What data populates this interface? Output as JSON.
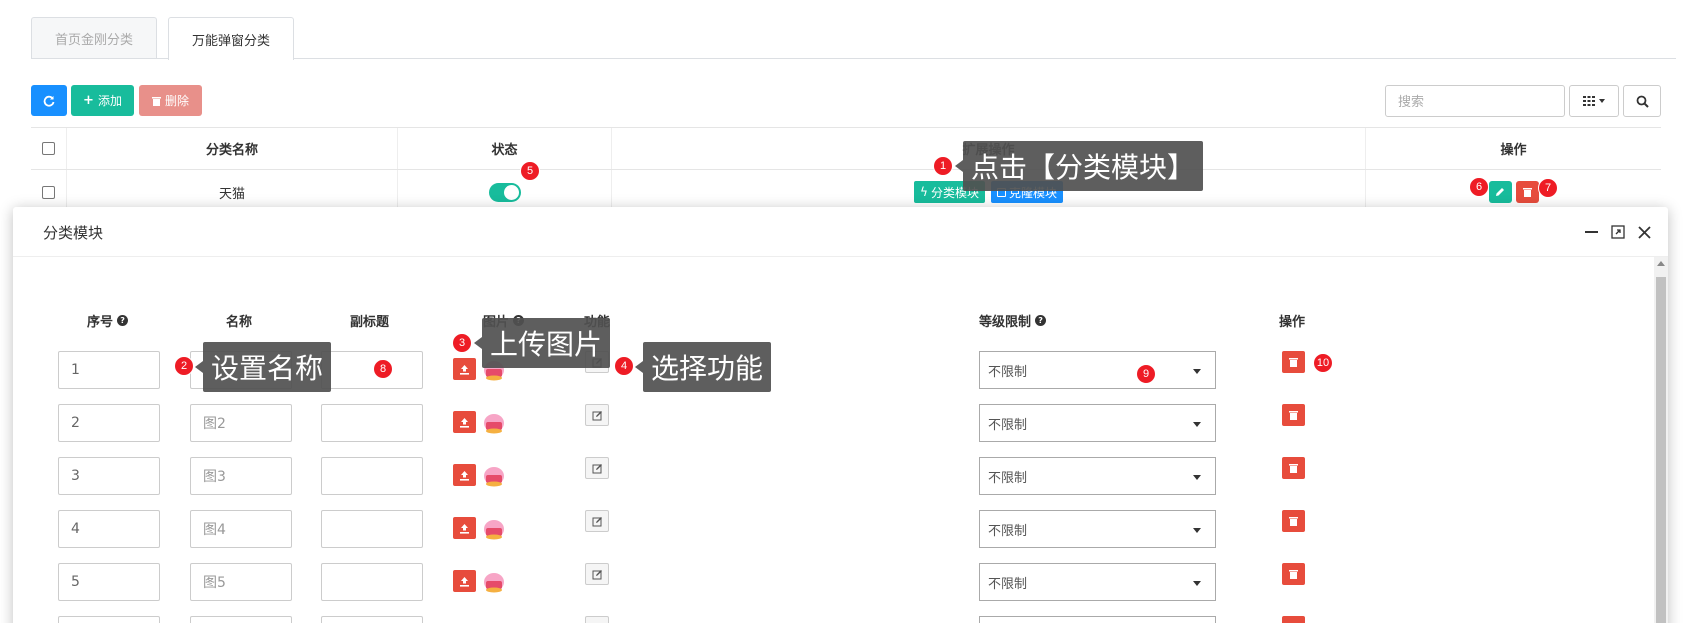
{
  "tabs": [
    {
      "label": "首页金刚分类"
    },
    {
      "label": "万能弹窗分类"
    }
  ],
  "toolbar": {
    "add_label": "添加",
    "delete_label": "删除",
    "search_placeholder": "搜索"
  },
  "table": {
    "headers": {
      "name": "分类名称",
      "status": "状态",
      "ext": "扩展操作",
      "op": "操作"
    },
    "rows": [
      {
        "name": "天猫",
        "status_on": true,
        "btn_module": "分类模块",
        "btn_clone": "克隆模块"
      }
    ]
  },
  "modal": {
    "title": "分类模块",
    "headers": {
      "seq": "序号",
      "name": "名称",
      "subtitle": "副标题",
      "image": "图片",
      "function": "功能",
      "level": "等级限制",
      "op": "操作"
    },
    "rows": [
      {
        "seq": "1",
        "name": "",
        "subtitle": "",
        "level": "不限制"
      },
      {
        "seq": "2",
        "name": "图2",
        "subtitle": "",
        "level": "不限制"
      },
      {
        "seq": "3",
        "name": "图3",
        "subtitle": "",
        "level": "不限制"
      },
      {
        "seq": "4",
        "name": "图4",
        "subtitle": "",
        "level": "不限制"
      },
      {
        "seq": "5",
        "name": "图5",
        "subtitle": "",
        "level": "不限制"
      }
    ]
  },
  "annotations": {
    "badges": [
      "1",
      "2",
      "3",
      "4",
      "5",
      "6",
      "7",
      "8",
      "9",
      "10"
    ],
    "callouts": {
      "c1": "点击【分类模块】",
      "c2": "设置名称",
      "c3": "上传图片",
      "c4": "选择功能"
    }
  },
  "colors": {
    "primary": "#1890ff",
    "success": "#18bc9c",
    "danger": "#e74c3c",
    "annotation": "#ee1c25"
  }
}
